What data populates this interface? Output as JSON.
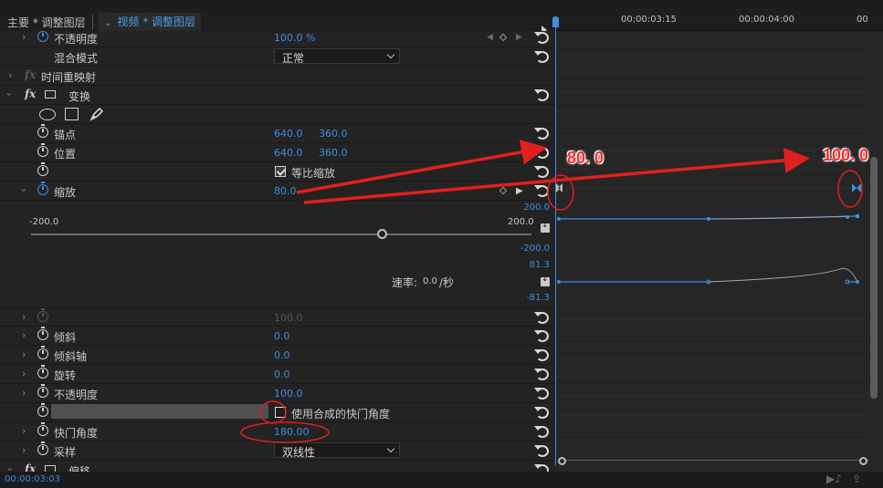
{
  "tabs": {
    "master": "主要 * 调整图层",
    "active": "视频 * 调整图层"
  },
  "ruler": {
    "t1": "00:00:03:15",
    "t2": "00:00:04:00",
    "t3": "00"
  },
  "rows": {
    "opacity_top": {
      "label": "不透明度",
      "value": "100.0 %"
    },
    "blend": {
      "label": "混合模式",
      "value": "正常"
    },
    "time_remap": {
      "label": "时间重映射"
    },
    "transform": {
      "label": "变换"
    },
    "anchor": {
      "label": "锚点",
      "x": "640.0",
      "y": "360.0"
    },
    "position": {
      "label": "位置",
      "x": "640.0",
      "y": "360.0"
    },
    "uniform_scale": {
      "label": "等比缩放"
    },
    "scale": {
      "label": "缩放",
      "value": "80.0"
    },
    "slider_min": "-200.0",
    "slider_max": "200.0",
    "velocity": {
      "label": "速率:",
      "value": "0.0",
      "unit": "/秒"
    },
    "scale_width": {
      "value": "100.0"
    },
    "skew": {
      "label": "倾斜",
      "value": "0.0"
    },
    "skew_axis": {
      "label": "倾斜轴",
      "value": "0.0"
    },
    "rotation": {
      "label": "旋转",
      "value": "0.0"
    },
    "opacity": {
      "label": "不透明度",
      "value": "100.0"
    },
    "composite_shutter": {
      "label": "使用合成的快门角度"
    },
    "shutter_angle": {
      "label": "快门角度",
      "value": "180.00"
    },
    "sampling": {
      "label": "采样",
      "value": "双线性"
    },
    "offset": {
      "label": "偏移"
    }
  },
  "graph": {
    "val_top": "200.0",
    "val_bottom": "-200.0",
    "vel_top": "81.3",
    "vel_bottom": "-81.3"
  },
  "annotations": {
    "left_value": "80. 0",
    "right_value": "100. 0"
  },
  "status": {
    "timecode": "00:00:03:03"
  },
  "colors": {
    "accent": "#3d8ee0",
    "annotation": "#ff2a2a"
  }
}
